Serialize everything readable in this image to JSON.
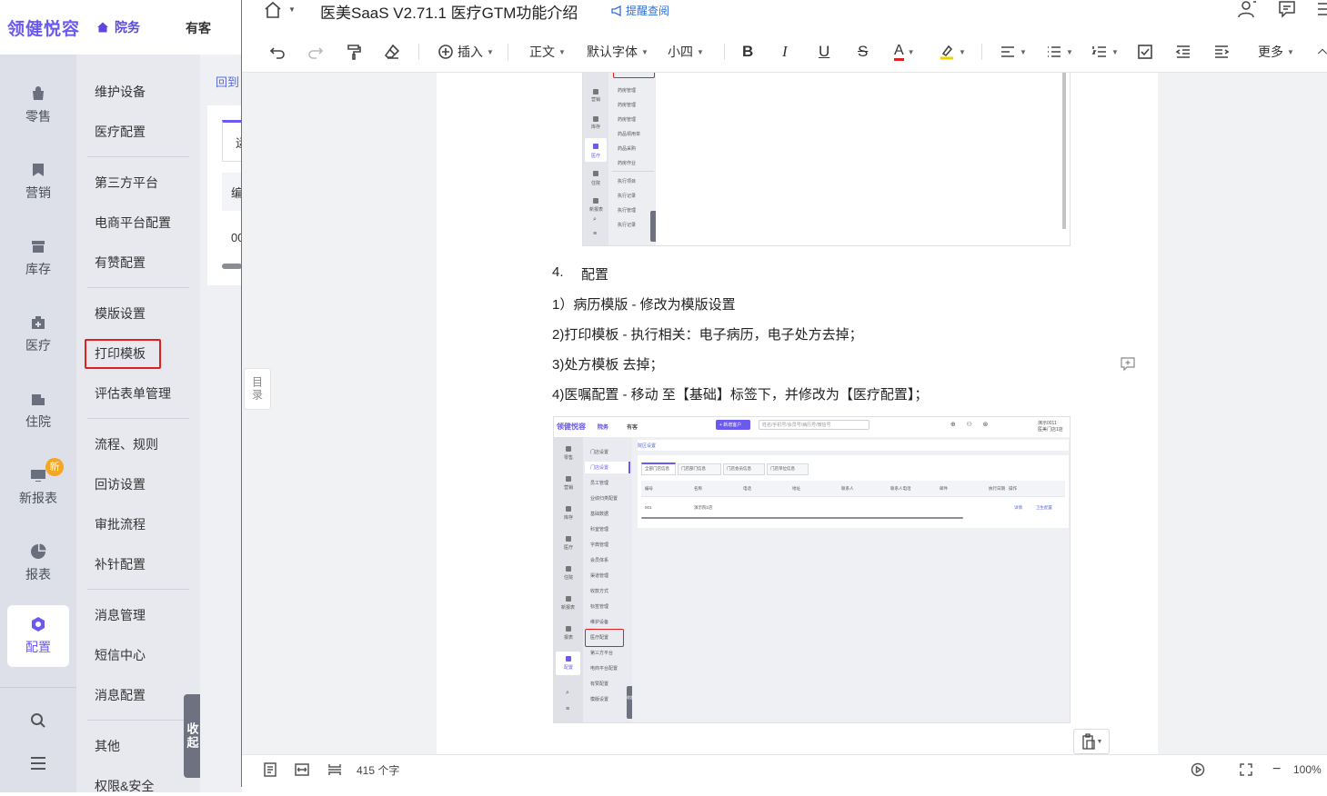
{
  "app": {
    "brand": "领健悦容",
    "nav": {
      "yuanwu": "院务",
      "youke": "有客"
    },
    "rail": [
      {
        "label": "零售",
        "icon": "bag-icon"
      },
      {
        "label": "营销",
        "icon": "bookmark-icon"
      },
      {
        "label": "库存",
        "icon": "box-icon"
      },
      {
        "label": "医疗",
        "icon": "medkit-icon"
      },
      {
        "label": "住院",
        "icon": "hospital-icon"
      },
      {
        "label": "新报表",
        "icon": "screen-icon",
        "badge": "新"
      },
      {
        "label": "报表",
        "icon": "pie-icon"
      },
      {
        "label": "配置",
        "icon": "hexagon-icon",
        "active": true
      }
    ],
    "submenu": [
      "维护设备",
      "医疗配置",
      "第三方平台",
      "电商平台配置",
      "有赞配置",
      "模版设置",
      "打印模板",
      "评估表单管理",
      "流程、规则",
      "回访设置",
      "审批流程",
      "补针配置",
      "消息管理",
      "短信中心",
      "消息配置",
      "其他",
      "权限&安全"
    ],
    "collapse": "收起",
    "back_link": "回到",
    "fragments": {
      "tab": "运",
      "th": "编",
      "td": "00"
    }
  },
  "doc": {
    "title": "医美SaaS V2.71.1 医疗GTM功能介绍",
    "remind": "提醒查阅",
    "toolbar": {
      "insert": "插入",
      "style": "正文",
      "font": "默认字体",
      "size": "小四",
      "more": "更多"
    },
    "toc": "目录",
    "item4_num": "4.",
    "item4_text": "配置",
    "lines": [
      "1）病历模版 - 修改为模版设置",
      "2)打印模板 - 执行相关：电子病历，电子处方去掉；",
      "3)处方模板 去掉；",
      "4)医嘱配置 - 移动 至【基础】标签下，并修改为【医疗配置】；"
    ],
    "word_count": "415 个字",
    "zoom": "100%",
    "shot1": {
      "rail": [
        "营销",
        "库存",
        "医疗",
        "住院",
        "新报表"
      ],
      "sub": [
        "药房管理",
        "药房管理",
        "药房管理",
        "药品领用单",
        "药品采购",
        "药房作业",
        "执行项目",
        "执行记录",
        "执行管理",
        "执行记录"
      ]
    },
    "shot2": {
      "brand": "领健悦容",
      "nav": [
        "院务",
        "有客"
      ],
      "new_btn": "+ 新增客户",
      "search_ph": "姓名/手机号/会员号/病历号/微信号",
      "store": "演示0011",
      "store2": "医美门店1店",
      "crumb": "院区设置",
      "tabs": [
        "全部门店信息",
        "门店部门信息",
        "门店会员信息",
        "门店单位信息"
      ],
      "cols": [
        "编号",
        "名称",
        "电话",
        "地址",
        "联系人",
        "联系人电话",
        "邮件",
        "执行日期",
        "操作"
      ],
      "row": [
        "001",
        "演示院1店"
      ],
      "ops": [
        "详情",
        "卫生配置"
      ],
      "rail": [
        "零售",
        "营销",
        "库存",
        "医疗",
        "住院",
        "新报表",
        "报表",
        "配置"
      ],
      "sub": [
        "门店设置",
        "门店设置",
        "员工管理",
        "业绩归类配置",
        "基础数据",
        "科室管理",
        "字典管理",
        "会员体系",
        "渠道管理",
        "收款方式",
        "标签管理",
        "维护设备",
        "医疗配置",
        "第三方平台",
        "电商平台配置",
        "有赞配置",
        "模版设置"
      ],
      "collapse": "收起"
    }
  }
}
